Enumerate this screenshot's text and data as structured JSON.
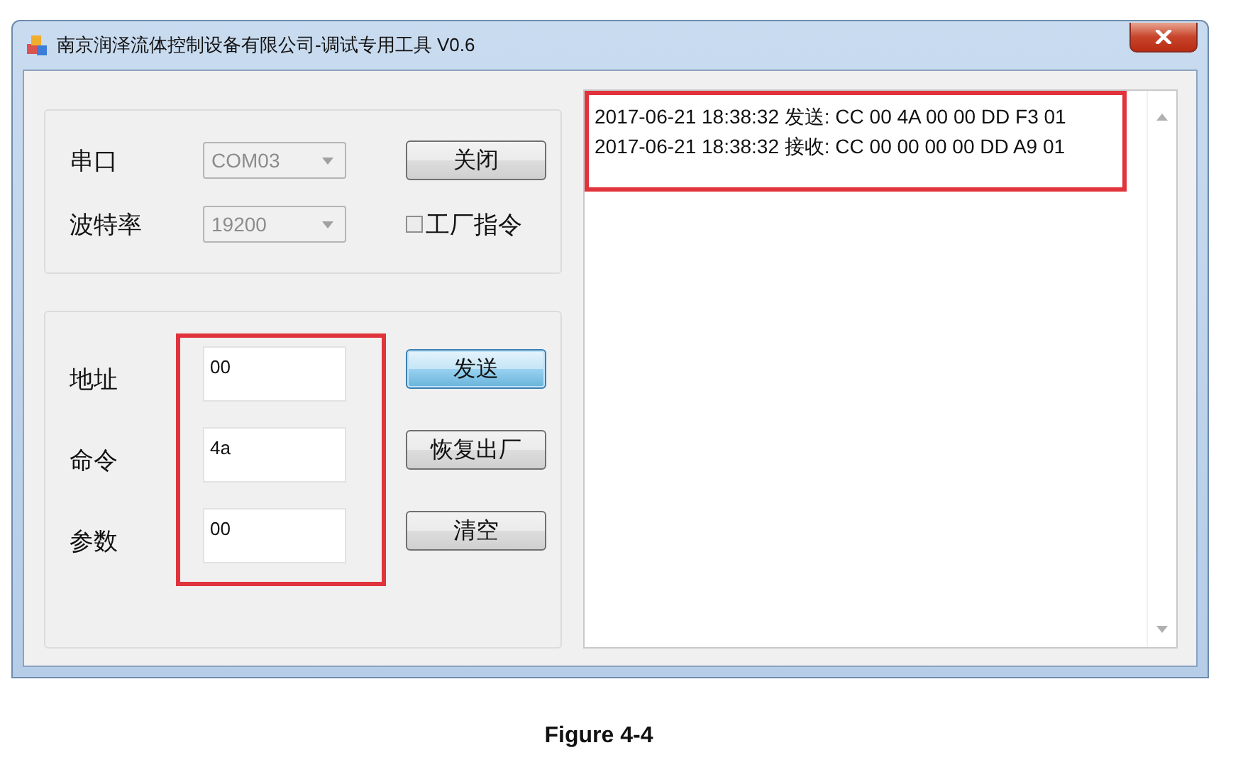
{
  "window": {
    "title": "南京润泽流体控制设备有限公司-调试专用工具 V0.6"
  },
  "serial_group": {
    "combos": [
      {
        "label": "串口",
        "value": "COM03",
        "disabled": true
      },
      {
        "label": "波特率",
        "value": "19200",
        "disabled": true
      }
    ],
    "button": {
      "label": "关闭",
      "focused": false
    },
    "checkbox": {
      "label": "工厂指令",
      "checked": false
    }
  },
  "command_group": {
    "highlighted": true,
    "fields": [
      {
        "label": "地址",
        "value": "00"
      },
      {
        "label": "命令",
        "value": "4a"
      },
      {
        "label": "参数",
        "value": "00"
      }
    ],
    "buttons": [
      {
        "label": "发送",
        "focused": true
      },
      {
        "label": "恢复出厂",
        "focused": false
      },
      {
        "label": "清空",
        "focused": false
      }
    ]
  },
  "log": {
    "highlighted": true,
    "lines": [
      "2017-06-21 18:38:32 发送: CC 00 4A 00 00 DD F3 01",
      "2017-06-21 18:38:32 接收: CC 00 00 00 00 DD A9 01"
    ]
  },
  "caption": "Figure 4-4"
}
